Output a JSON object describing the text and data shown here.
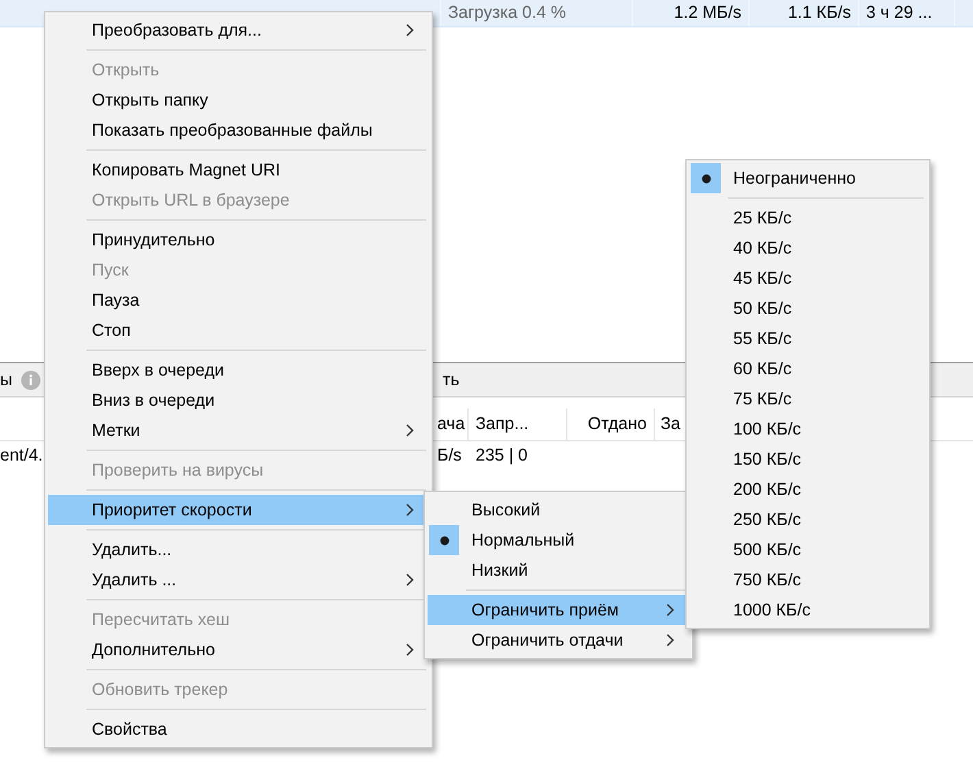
{
  "top_row": {
    "cells": [
      "Загрузка 0.4 %",
      "1.2 МБ/s",
      "1.1 КБ/s",
      "3 ч 29 ..."
    ]
  },
  "tab_bar": {
    "items": [
      "ы",
      "ть"
    ]
  },
  "table": {
    "columns": [
      "",
      "ача",
      "Запр...",
      "Отдано",
      "За"
    ],
    "rows": [
      [
        "ent/4.",
        "Б/s",
        "235 | 0"
      ]
    ]
  },
  "context_menu": {
    "items": [
      {
        "kind": "item",
        "label": "Преобразовать для...",
        "disabled": false,
        "submenu": true,
        "selected": false
      },
      {
        "kind": "separator"
      },
      {
        "kind": "item",
        "label": "Открыть",
        "disabled": true,
        "submenu": false,
        "selected": false
      },
      {
        "kind": "item",
        "label": "Открыть папку",
        "disabled": false,
        "submenu": false,
        "selected": false
      },
      {
        "kind": "item",
        "label": "Показать преобразованные файлы",
        "disabled": false,
        "submenu": false,
        "selected": false
      },
      {
        "kind": "separator"
      },
      {
        "kind": "item",
        "label": "Копировать Magnet URI",
        "disabled": false,
        "submenu": false,
        "selected": false
      },
      {
        "kind": "item",
        "label": "Открыть URL в браузере",
        "disabled": true,
        "submenu": false,
        "selected": false
      },
      {
        "kind": "separator"
      },
      {
        "kind": "item",
        "label": "Принудительно",
        "disabled": false,
        "submenu": false,
        "selected": false
      },
      {
        "kind": "item",
        "label": "Пуск",
        "disabled": true,
        "submenu": false,
        "selected": false
      },
      {
        "kind": "item",
        "label": "Пауза",
        "disabled": false,
        "submenu": false,
        "selected": false
      },
      {
        "kind": "item",
        "label": "Стоп",
        "disabled": false,
        "submenu": false,
        "selected": false
      },
      {
        "kind": "separator"
      },
      {
        "kind": "item",
        "label": "Вверх в очереди",
        "disabled": false,
        "submenu": false,
        "selected": false
      },
      {
        "kind": "item",
        "label": "Вниз в очереди",
        "disabled": false,
        "submenu": false,
        "selected": false
      },
      {
        "kind": "item",
        "label": "Метки",
        "disabled": false,
        "submenu": true,
        "selected": false
      },
      {
        "kind": "separator"
      },
      {
        "kind": "item",
        "label": "Проверить на вирусы",
        "disabled": true,
        "submenu": false,
        "selected": false
      },
      {
        "kind": "separator"
      },
      {
        "kind": "item",
        "label": "Приоритет скорости",
        "disabled": false,
        "submenu": true,
        "selected": true
      },
      {
        "kind": "separator"
      },
      {
        "kind": "item",
        "label": "Удалить...",
        "disabled": false,
        "submenu": false,
        "selected": false
      },
      {
        "kind": "item",
        "label": "Удалить ...",
        "disabled": false,
        "submenu": true,
        "selected": false
      },
      {
        "kind": "separator"
      },
      {
        "kind": "item",
        "label": "Пересчитать хеш",
        "disabled": true,
        "submenu": false,
        "selected": false
      },
      {
        "kind": "item",
        "label": "Дополнительно",
        "disabled": false,
        "submenu": true,
        "selected": false
      },
      {
        "kind": "separator"
      },
      {
        "kind": "item",
        "label": "Обновить трекер",
        "disabled": true,
        "submenu": false,
        "selected": false
      },
      {
        "kind": "separator"
      },
      {
        "kind": "item",
        "label": "Свойства",
        "disabled": false,
        "submenu": false,
        "selected": false
      }
    ]
  },
  "priority_menu": {
    "items": [
      {
        "kind": "item",
        "label": "Высокий",
        "checked": false,
        "submenu": false,
        "selected": false
      },
      {
        "kind": "item",
        "label": "Нормальный",
        "checked": true,
        "submenu": false,
        "selected": false
      },
      {
        "kind": "item",
        "label": "Низкий",
        "checked": false,
        "submenu": false,
        "selected": false
      },
      {
        "kind": "separator"
      },
      {
        "kind": "item",
        "label": "Ограничить приём",
        "checked": false,
        "submenu": true,
        "selected": true
      },
      {
        "kind": "item",
        "label": "Ограничить отдачи",
        "checked": false,
        "submenu": true,
        "selected": false
      }
    ]
  },
  "speed_menu": {
    "items": [
      {
        "kind": "item",
        "label": "Неограниченно",
        "checked": true
      },
      {
        "kind": "separator"
      },
      {
        "kind": "item",
        "label": "25 КБ/с",
        "checked": false
      },
      {
        "kind": "item",
        "label": "40 КБ/с",
        "checked": false
      },
      {
        "kind": "item",
        "label": "45 КБ/с",
        "checked": false
      },
      {
        "kind": "item",
        "label": "50 КБ/с",
        "checked": false
      },
      {
        "kind": "item",
        "label": "55 КБ/с",
        "checked": false
      },
      {
        "kind": "item",
        "label": "60 КБ/с",
        "checked": false
      },
      {
        "kind": "item",
        "label": "75 КБ/с",
        "checked": false
      },
      {
        "kind": "item",
        "label": "100 КБ/с",
        "checked": false
      },
      {
        "kind": "item",
        "label": "150 КБ/с",
        "checked": false
      },
      {
        "kind": "item",
        "label": "200 КБ/с",
        "checked": false
      },
      {
        "kind": "item",
        "label": "250 КБ/с",
        "checked": false
      },
      {
        "kind": "item",
        "label": "500 КБ/с",
        "checked": false
      },
      {
        "kind": "item",
        "label": "750 КБ/с",
        "checked": false
      },
      {
        "kind": "item",
        "label": "1000 КБ/с",
        "checked": false
      }
    ]
  }
}
